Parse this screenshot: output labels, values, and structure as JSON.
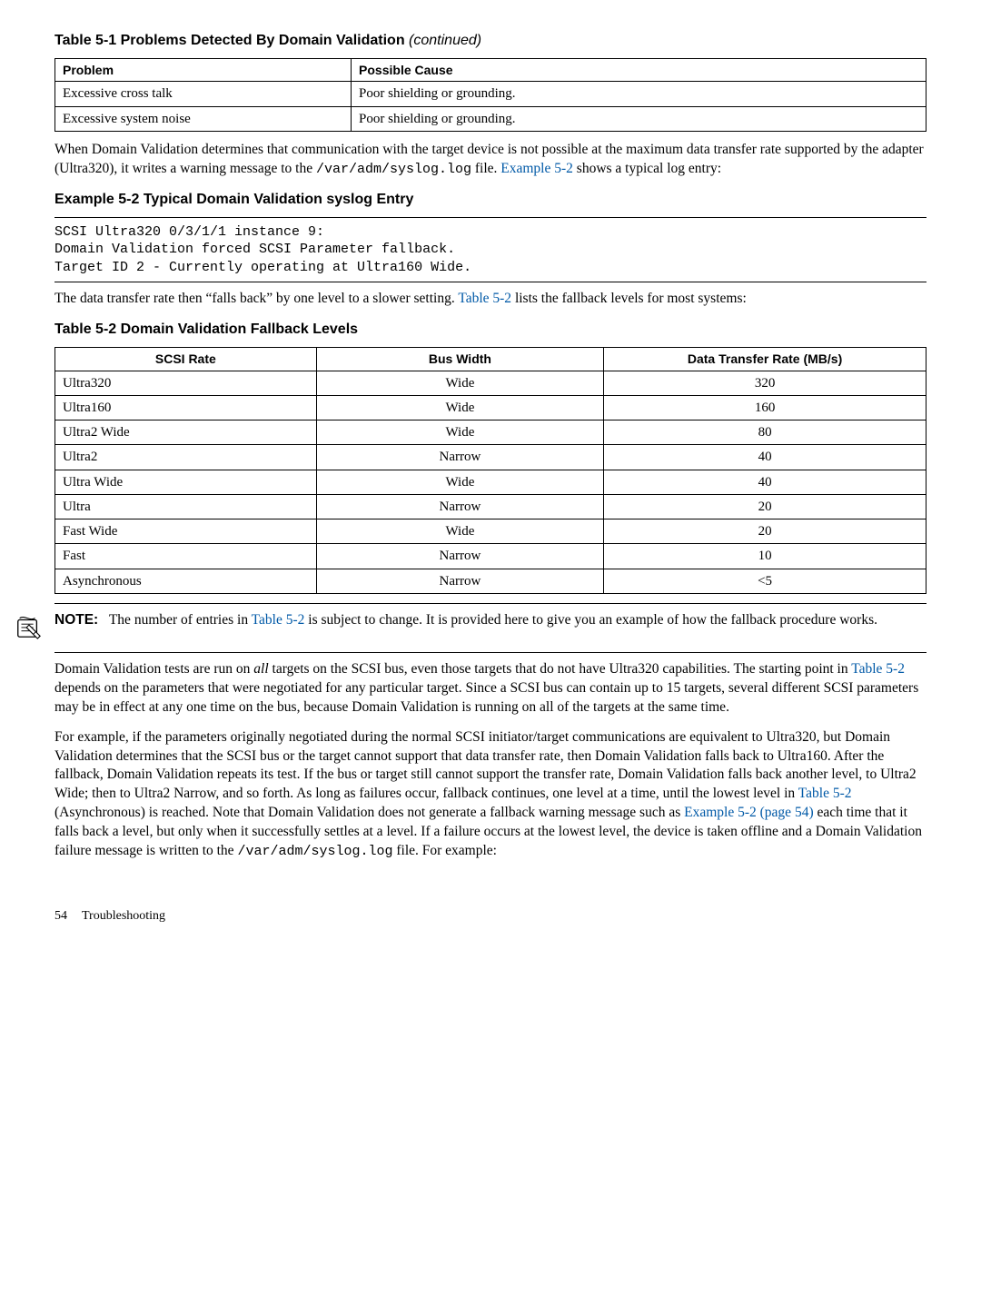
{
  "table51": {
    "caption_prefix": "Table  5-1  Problems Detected By Domain Validation",
    "caption_suffix": " (continued)",
    "headers": {
      "c0": "Problem",
      "c1": "Possible Cause"
    },
    "rows": [
      {
        "c0": "Excessive cross talk",
        "c1": "Poor shielding or grounding."
      },
      {
        "c0": "Excessive system noise",
        "c1": "Poor shielding or grounding."
      }
    ]
  },
  "para1": {
    "pre": "When Domain Validation determines that communication with the target device is not possible at the maximum data transfer rate supported by the adapter (Ultra320), it writes a warning message to the ",
    "code": "/var/adm/syslog.log",
    "mid": " file. ",
    "link": "Example 5-2",
    "post": " shows a typical log entry:"
  },
  "example52": {
    "heading": "Example  5-2  Typical Domain Validation syslog Entry",
    "line1": "SCSI Ultra320 0/3/1/1 instance 9:",
    "line2": "Domain Validation forced SCSI Parameter fallback.",
    "line3": "Target ID 2 - Currently operating at Ultra160 Wide."
  },
  "para2": {
    "pre": "The data transfer rate then “falls back” by one level to a slower setting. ",
    "link": "Table 5-2",
    "post": " lists the fallback levels for most systems:"
  },
  "table52": {
    "caption": "Table  5-2  Domain Validation Fallback Levels",
    "headers": {
      "c0": "SCSI Rate",
      "c1": "Bus Width",
      "c2": "Data Transfer Rate (MB/s)"
    },
    "rows": [
      {
        "c0": "Ultra320",
        "c1": "Wide",
        "c2": "320"
      },
      {
        "c0": "Ultra160",
        "c1": "Wide",
        "c2": "160"
      },
      {
        "c0": "Ultra2 Wide",
        "c1": "Wide",
        "c2": "80"
      },
      {
        "c0": "Ultra2",
        "c1": "Narrow",
        "c2": "40"
      },
      {
        "c0": "Ultra Wide",
        "c1": "Wide",
        "c2": "40"
      },
      {
        "c0": "Ultra",
        "c1": "Narrow",
        "c2": "20"
      },
      {
        "c0": "Fast Wide",
        "c1": "Wide",
        "c2": "20"
      },
      {
        "c0": "Fast",
        "c1": "Narrow",
        "c2": "10"
      },
      {
        "c0": "Asynchronous",
        "c1": "Narrow",
        "c2": "<5"
      }
    ]
  },
  "note": {
    "label": "NOTE:",
    "pre": "The number of entries in ",
    "link": "Table 5-2",
    "post": " is subject to change. It is provided here to give you an example of how the fallback procedure works."
  },
  "para3": {
    "s1": "Domain Validation tests are run on ",
    "em": "all",
    "s2": " targets on the SCSI bus, even those targets that do not have Ultra320 capabilities. The starting point in ",
    "link": "Table 5-2",
    "s3": " depends on the parameters that were negotiated for any particular target. Since a SCSI bus can contain up to 15 targets, several different SCSI parameters may be in effect at any one time on the bus, because Domain Validation is running on all of the targets at the same time."
  },
  "para4": {
    "s1": "For example, if the parameters originally negotiated during the normal SCSI initiator/target communications are equivalent to Ultra320, but Domain Validation determines that the SCSI bus or the target cannot support that data transfer rate, then Domain Validation falls back to Ultra160. After the fallback, Domain Validation repeats its test. If the bus or target still cannot support the transfer rate, Domain Validation falls back another level, to Ultra2 Wide; then to Ultra2 Narrow, and so forth. As long as failures occur, fallback continues, one level at a time, until the lowest level in ",
    "link1": "Table 5-2",
    "s2": " (Asynchronous) is reached. Note that Domain Validation does not generate a fallback warning message such as ",
    "link2": "Example 5-2 (page 54)",
    "s3": " each time that it falls back a level, but only when it successfully settles at a level. If a failure occurs at the lowest level, the device is taken offline and a Domain Validation failure message is written to the ",
    "code": "/var/adm/syslog.log",
    "s4": " file. For example:"
  },
  "footer": {
    "page": "54",
    "section": "Troubleshooting"
  }
}
